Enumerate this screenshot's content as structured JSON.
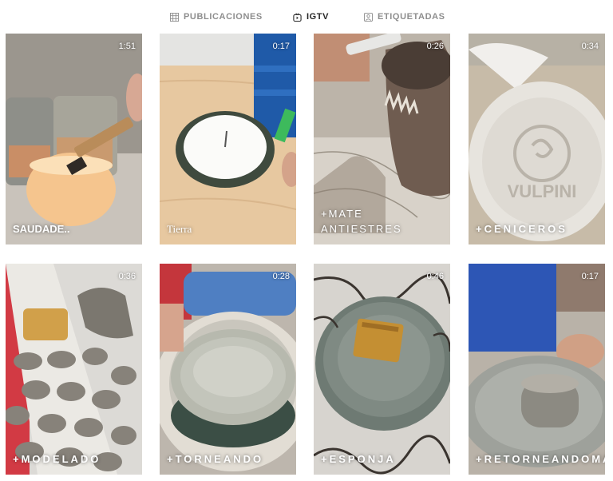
{
  "tabs": [
    {
      "label": "PUBLICACIONES",
      "icon": "grid-icon",
      "active": false
    },
    {
      "label": "IGTV",
      "icon": "igtv-icon",
      "active": true
    },
    {
      "label": "ETIQUETADAS",
      "icon": "tag-icon",
      "active": false
    }
  ],
  "videos": [
    {
      "title": "SAUDADE..",
      "duration": "1:51"
    },
    {
      "title": "Tierra",
      "duration": "0:17"
    },
    {
      "title": "+MATE ANTIESTRES",
      "duration": "0:26"
    },
    {
      "title": "+CENICEROS",
      "duration": "0:34"
    },
    {
      "title": "+MODELADO",
      "duration": "0:36"
    },
    {
      "title": "+TORNEANDO",
      "duration": "0:28"
    },
    {
      "title": "+ESPONJA",
      "duration": "0:46"
    },
    {
      "title": "+RETORNEANDOMATES",
      "duration": "0:17"
    }
  ],
  "logo_text": "VULPINI"
}
